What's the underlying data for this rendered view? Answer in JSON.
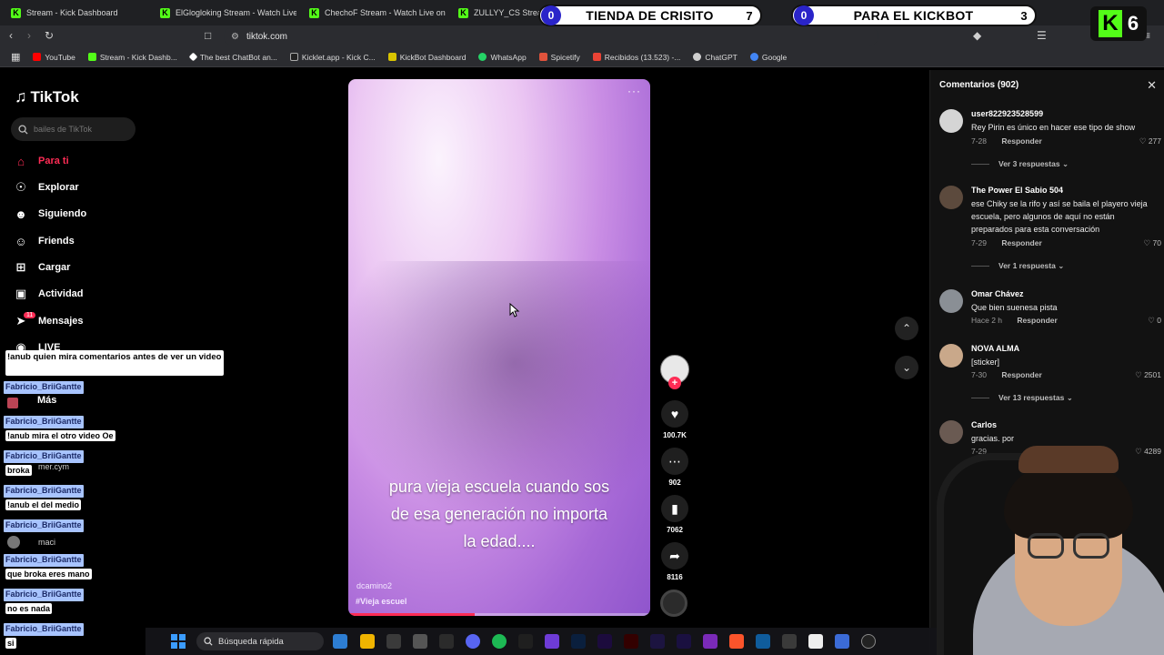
{
  "browser": {
    "tabs": [
      {
        "label": "Stream - Kick Dashboard"
      },
      {
        "label": "ElGlogloking Stream - Watch Live on"
      },
      {
        "label": "ChechoF Stream - Watch Live on Kick"
      },
      {
        "label": "ZULLYY_CS Stream -"
      }
    ],
    "url": "tiktok.com",
    "bookmarks": [
      {
        "label": "YouTube"
      },
      {
        "label": "Stream - Kick Dashb..."
      },
      {
        "label": "The best ChatBot an..."
      },
      {
        "label": "Kicklet.app - Kick C..."
      },
      {
        "label": "KickBot Dashboard"
      },
      {
        "label": "WhatsApp"
      },
      {
        "label": "Spicetify"
      },
      {
        "label": "Recibidos (13.523) -..."
      },
      {
        "label": "ChatGPT"
      },
      {
        "label": "Google"
      }
    ]
  },
  "overlays": {
    "counter1": {
      "left": "0",
      "label": "TIENDA DE CRISITO",
      "right": "7"
    },
    "counter2": {
      "left": "0",
      "label": "PARA EL KICKBOT",
      "right": "3"
    },
    "kick_badge": {
      "letter": "K",
      "count": "6"
    }
  },
  "sidebar": {
    "logo": "TikTok",
    "search_placeholder": "bailes de TikTok",
    "items": [
      {
        "label": "Para ti",
        "icon": "home-icon"
      },
      {
        "label": "Explorar",
        "icon": "compass-icon"
      },
      {
        "label": "Siguiendo",
        "icon": "following-icon"
      },
      {
        "label": "Friends",
        "icon": "friends-icon"
      },
      {
        "label": "Cargar",
        "icon": "upload-icon"
      },
      {
        "label": "Actividad",
        "icon": "activity-icon"
      },
      {
        "label": "Mensajes",
        "icon": "messages-icon"
      },
      {
        "label": "LIVE",
        "icon": "live-icon"
      },
      {
        "label": "Más",
        "icon": "more-icon"
      }
    ],
    "messages_badge": "11"
  },
  "chat": {
    "first_message": "!anub quien mira comentarios antes de ver un video",
    "entries": [
      {
        "user": "Fabricio_BriiGantte",
        "msg": "!anub mira el otro video Oe"
      },
      {
        "user": "Fabricio_BriiGantte",
        "msg": "broka"
      },
      {
        "user": "Fabricio_BriiGantte",
        "msg": "!anub el del medio"
      },
      {
        "user": "Fabricio_BriiGantte",
        "msg": "que broka eres mano"
      },
      {
        "user": "Fabricio_BriiGantte",
        "msg": "no es nada"
      },
      {
        "user": "Fabricio_BriiGantte",
        "msg": "si"
      }
    ],
    "ghost_texts": [
      "mer.cym",
      "maci"
    ]
  },
  "video": {
    "caption_lines": [
      "pura vieja escuela cuando sos",
      "de esa generación no importa",
      "la edad...."
    ],
    "author": "dcamino2",
    "tags": "#Vieja escuel",
    "progress": 0.42,
    "actions": {
      "likes": "100.7K",
      "comments": "902",
      "saves": "7062",
      "shares": "8116"
    }
  },
  "comments_panel": {
    "title": "Comentarios (902)",
    "reply_label": "Responder",
    "items": [
      {
        "user": "user822923528599",
        "text": "Rey Pirin es único en hacer ese tipo de show",
        "date": "7-28",
        "likes": "277",
        "more": "Ver 3 respuestas"
      },
      {
        "user": "The Power El Sabio 504",
        "text": "ese Chiky se la rifo y así se baila el playero vieja escuela, pero algunos de aquí no están preparados para esta conversación",
        "date": "7-29",
        "likes": "70",
        "more": "Ver 1 respuesta"
      },
      {
        "user": "Omar Chávez",
        "text": "Que bien suenesa pista",
        "date": "Hace 2 h",
        "likes": "0",
        "more": ""
      },
      {
        "user": "NOVA ALMA",
        "text": "[sticker]",
        "date": "7-30",
        "likes": "2501",
        "more": "Ver 13 respuestas"
      },
      {
        "user": "Carlos",
        "text": "gracias. por",
        "date": "7-29",
        "likes": "4289",
        "more": ""
      }
    ]
  },
  "taskbar": {
    "search_label": "Búsqueda rápida"
  },
  "colors": {
    "tiktok_red": "#fe2c55",
    "kick_green": "#53fc18",
    "chat_user_bg": "#a8c4ff",
    "counter_blue": "#2a24c9"
  }
}
